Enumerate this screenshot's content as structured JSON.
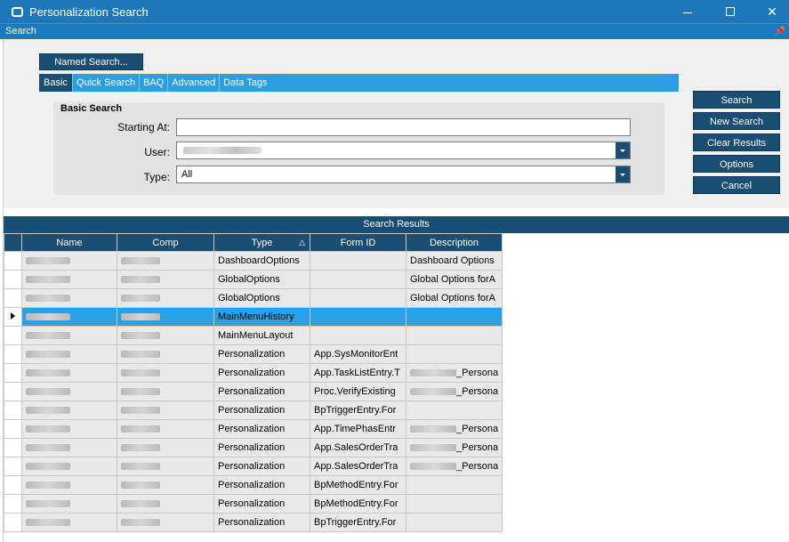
{
  "window": {
    "title": "Personalization Search"
  },
  "search_panel": {
    "title": "Search",
    "pin_icon": "pin-icon"
  },
  "toolbar": {
    "named_search_label": "Named Search..."
  },
  "tabs": [
    {
      "label": "Basic",
      "active": true
    },
    {
      "label": "Quick Search",
      "active": false
    },
    {
      "label": "BAQ",
      "active": false
    },
    {
      "label": "Advanced",
      "active": false
    },
    {
      "label": "Data Tags",
      "active": false
    }
  ],
  "basic_search": {
    "title": "Basic Search",
    "starting_at_label": "Starting At:",
    "starting_at_value": "",
    "user_label": "User:",
    "type_label": "Type:",
    "type_value": "All"
  },
  "buttons": {
    "search": "Search",
    "new_search": "New Search",
    "clear_results": "Clear Results",
    "options": "Options",
    "cancel": "Cancel"
  },
  "results": {
    "title": "Search Results",
    "columns": [
      "Name",
      "Comp",
      "Type",
      "Form ID",
      "Description"
    ],
    "rows": [
      {
        "type": "DashboardOptions",
        "form_id": "",
        "description": "Dashboard Options"
      },
      {
        "type": "GlobalOptions",
        "form_id": "",
        "description": "Global Options forA"
      },
      {
        "type": "GlobalOptions",
        "form_id": "",
        "description": "Global Options forA"
      },
      {
        "type": "MainMenuHistory",
        "form_id": "",
        "description": ""
      },
      {
        "type": "MainMenuLayout",
        "form_id": "",
        "description": ""
      },
      {
        "type": "Personalization",
        "form_id": "App.SysMonitorEnt",
        "description": ""
      },
      {
        "type": "Personalization",
        "form_id": "App.TaskListEntry.T",
        "description": "_Persona"
      },
      {
        "type": "Personalization",
        "form_id": "Proc.VerifyExisting",
        "description": "_Persona"
      },
      {
        "type": "Personalization",
        "form_id": "BpTriggerEntry.For",
        "description": ""
      },
      {
        "type": "Personalization",
        "form_id": "App.TimePhasEntr",
        "description": "_Persona"
      },
      {
        "type": "Personalization",
        "form_id": "App.SalesOrderTra",
        "description": "_Persona"
      },
      {
        "type": "Personalization",
        "form_id": "App.SalesOrderTra",
        "description": "_Persona"
      },
      {
        "type": "Personalization",
        "form_id": "BpMethodEntry.For",
        "description": ""
      },
      {
        "type": "Personalization",
        "form_id": "BpMethodEntry.For",
        "description": ""
      },
      {
        "type": "Personalization",
        "form_id": "BpTriggerEntry.For",
        "description": ""
      }
    ]
  }
}
